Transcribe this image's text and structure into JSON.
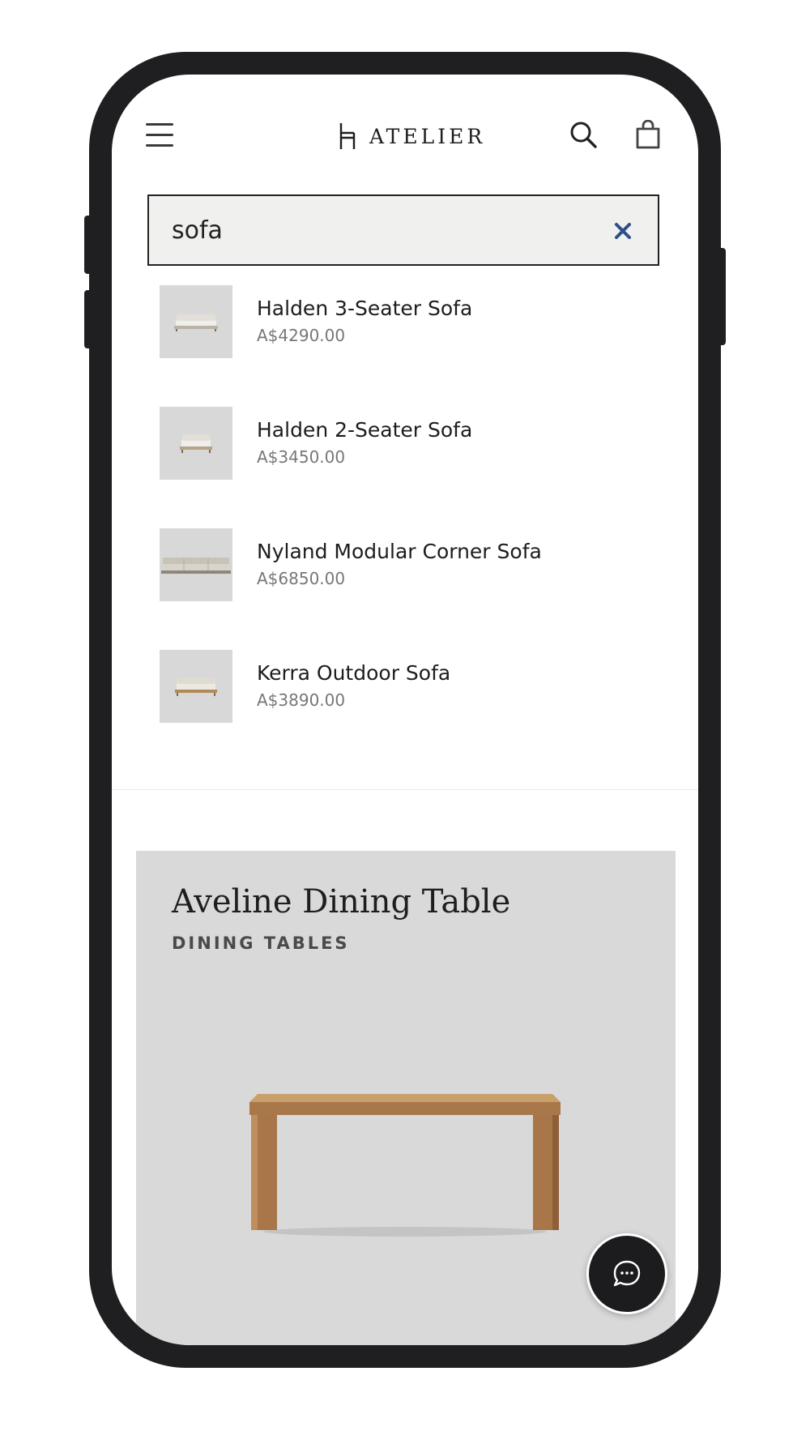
{
  "header": {
    "brand": "ATELIER"
  },
  "search": {
    "value": "sofa"
  },
  "results": [
    {
      "name": "Halden 3-Seater Sofa",
      "price": "A$4290.00"
    },
    {
      "name": "Halden 2-Seater Sofa",
      "price": "A$3450.00"
    },
    {
      "name": "Nyland Modular Corner Sofa",
      "price": "A$6850.00"
    },
    {
      "name": "Kerra Outdoor Sofa",
      "price": "A$3890.00"
    }
  ],
  "featured": {
    "title": "Aveline Dining Table",
    "category": "DINING TABLES"
  },
  "icons": {
    "menu": "hamburger-menu-icon",
    "search": "search-icon",
    "cart": "shopping-bag-icon",
    "clear": "close-icon",
    "chat": "chat-bubble-icon"
  },
  "colors": {
    "frame": "#1f1f21",
    "search_bg": "#f0f0ef",
    "clear_icon": "#2f4f8a",
    "thumb_bg": "#d8d8d8",
    "card_bg": "#d9d9d9",
    "price_text": "#777777"
  }
}
